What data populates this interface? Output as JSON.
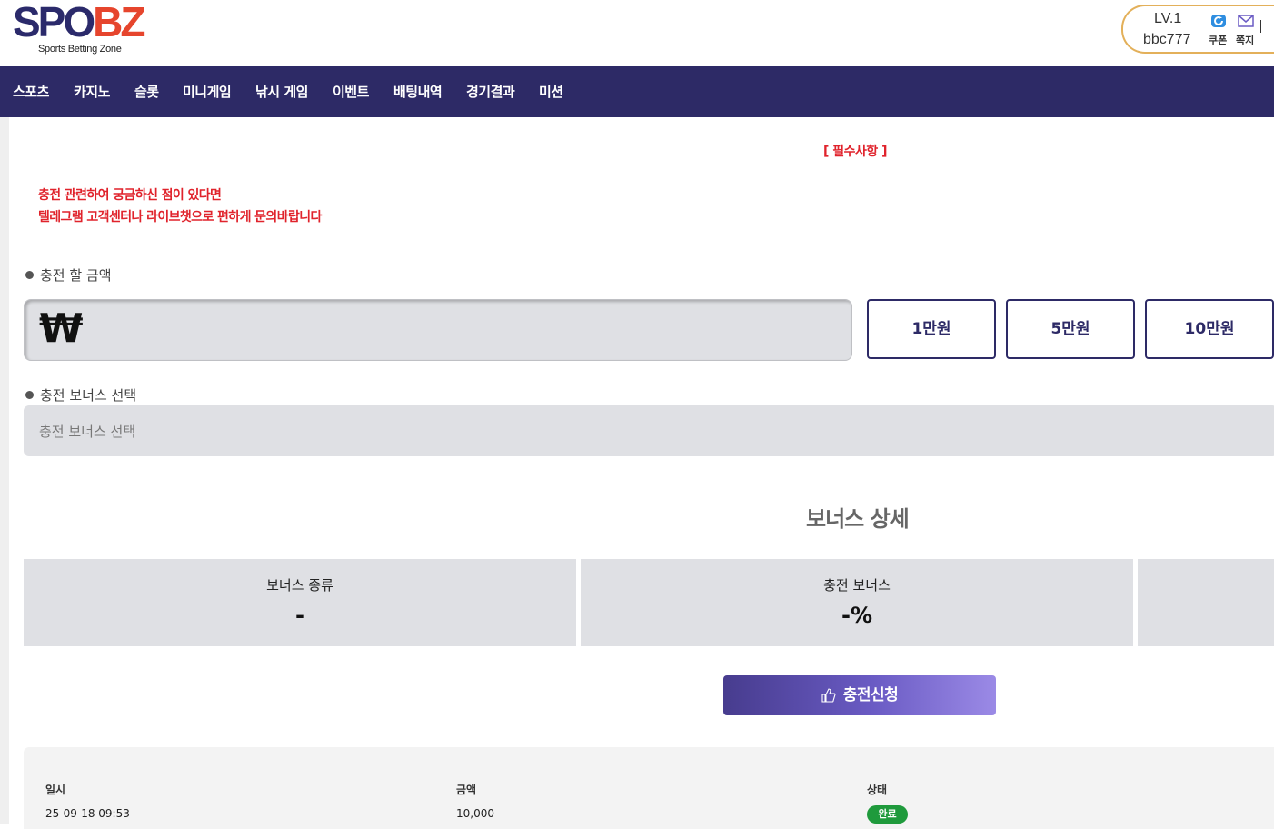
{
  "header": {
    "logo_main": "SPO",
    "logo_accent": "BZ",
    "logo_sub": "Sports Betting Zone",
    "level": "LV.1",
    "username": "bbc777",
    "coupon_label": "쿠폰",
    "message_label": "쪽지",
    "colors": {
      "brand": "#2b2a6b",
      "accent": "#e6452d",
      "user_border": "#e3b05a"
    }
  },
  "nav": {
    "items": [
      "스포츠",
      "카지노",
      "슬롯",
      "미니게임",
      "낚시 게임",
      "이벤트",
      "배팅내역",
      "경기결과",
      "미션"
    ],
    "background": "#2d2a66"
  },
  "notice": {
    "required": "[ 필수사항 ]",
    "line1": "충전 관련하여 궁금하신 점이 있다면",
    "line2": "텔레그램 고객센터나 라이브챗으로 편하게 문의바랍니다",
    "color": "#e0232c"
  },
  "charge": {
    "amount_label": "충전 할 금액",
    "currency_symbol": "₩",
    "amount_value": "",
    "quick_buttons": [
      "1만원",
      "5만원",
      "10만원"
    ]
  },
  "bonus": {
    "select_label": "충전 보너스 선택",
    "select_placeholder": "충전 보너스 선택",
    "detail_title": "보너스 상세",
    "cells": [
      {
        "label": "보너스 종류",
        "value": "-"
      },
      {
        "label": "충전 보너스",
        "value": "-%"
      },
      {
        "label": "",
        "value": ""
      }
    ]
  },
  "submit": {
    "label": "충전신청",
    "icon": "thumbs-up-icon"
  },
  "history": {
    "headers": [
      "일시",
      "금액",
      "상태"
    ],
    "rows": [
      {
        "datetime": "25-09-18 09:53",
        "amount": "10,000",
        "status": "완료"
      }
    ],
    "status_color": "#1f9a3c"
  }
}
